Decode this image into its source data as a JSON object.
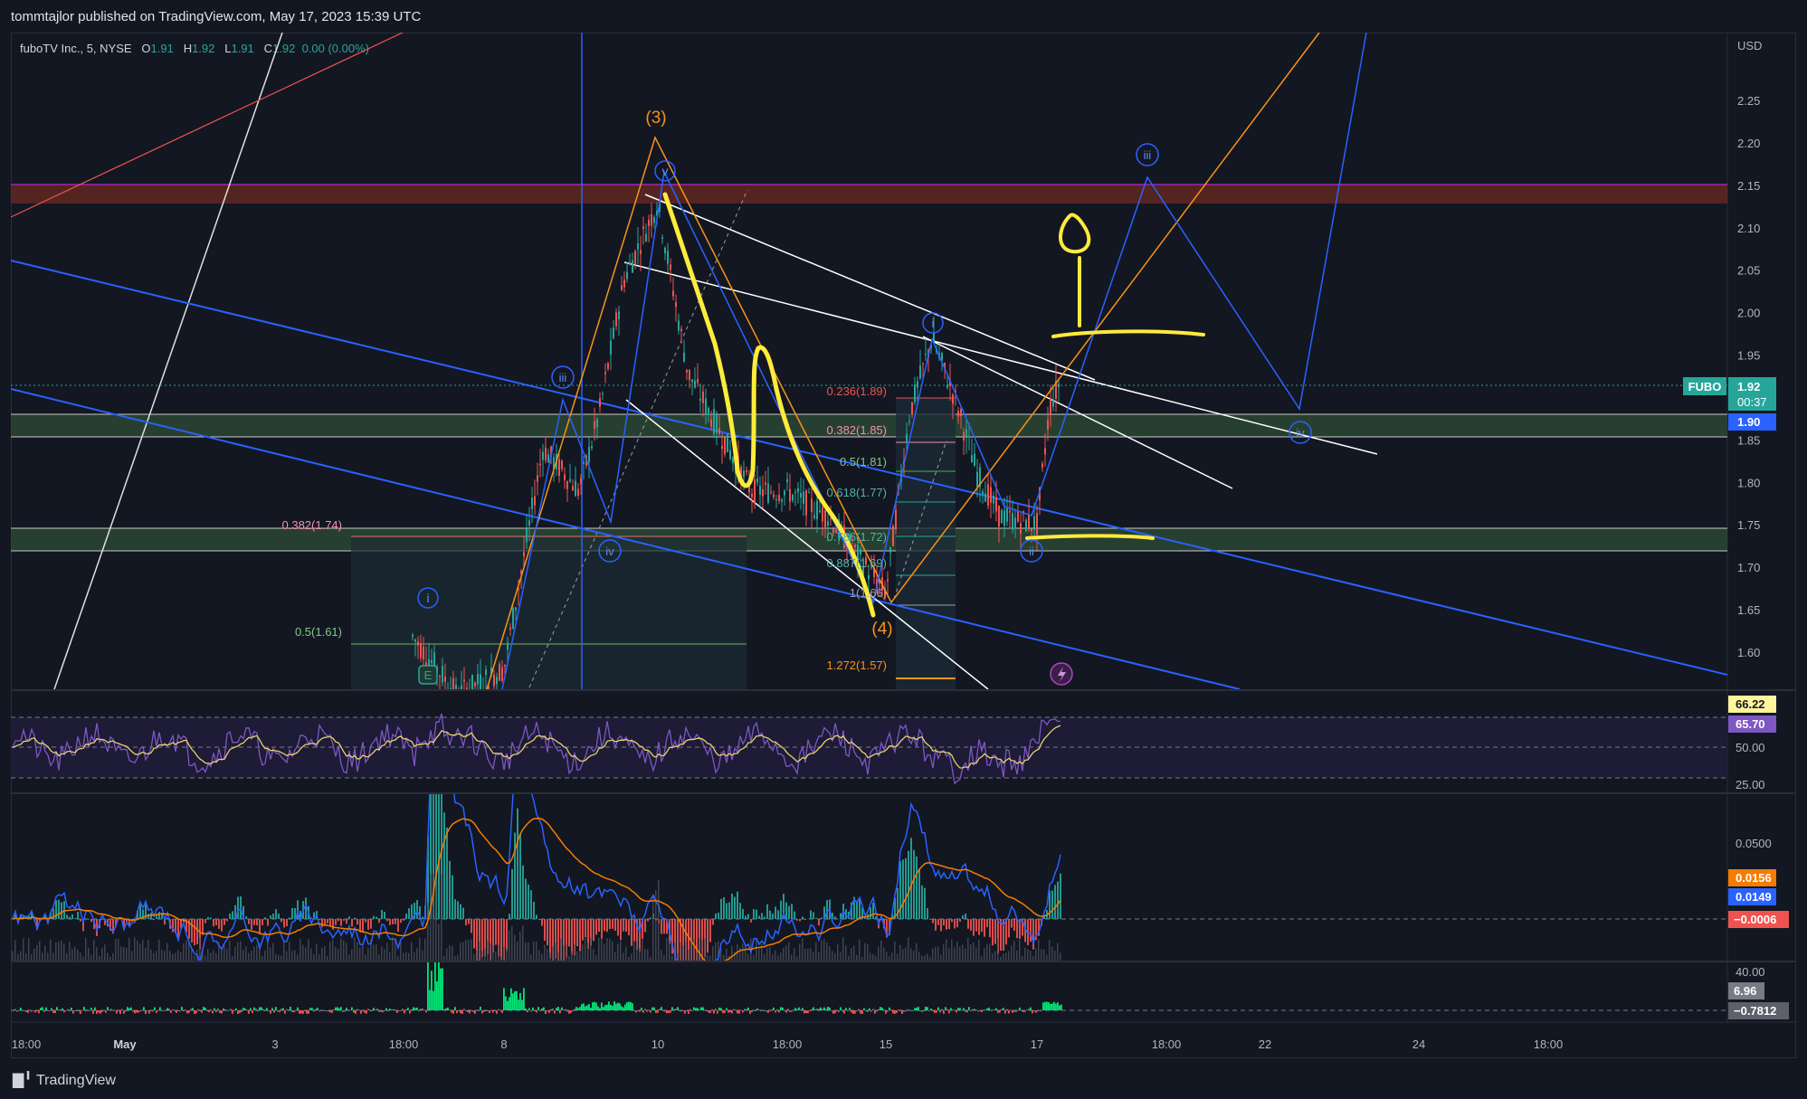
{
  "header": {
    "published_text": "tommtajlor published on TradingView.com, May 17, 2023 15:39 UTC"
  },
  "symbol_info": {
    "name": "fuboTV Inc., 5, NYSE",
    "o_label": "O",
    "o_value": "1.91",
    "h_label": "H",
    "h_value": "1.92",
    "l_label": "L",
    "l_value": "1.91",
    "c_label": "C",
    "c_value": "1.92",
    "change": "0.00 (0.00%)"
  },
  "footer": {
    "brand": "TradingView"
  },
  "colors": {
    "background": "#131722",
    "up": "#26a69a",
    "blue_lines": "#2962ff",
    "orange": "#f7931a",
    "yellow_marker": "#ffeb3b",
    "rsi_purple": "#7e57c2",
    "zone_red": "#a1412e",
    "zone_green": "#2f4d3a"
  },
  "price_axis": {
    "currency": "USD",
    "ticks": [
      "2.25",
      "2.20",
      "2.15",
      "2.10",
      "2.05",
      "2.00",
      "1.95",
      "1.90",
      "1.85",
      "1.80",
      "1.75",
      "1.70",
      "1.65",
      "1.60"
    ],
    "symbol_tag": "FUBO",
    "last_price": "1.92",
    "countdown": "00:37",
    "line_price": "1.90"
  },
  "rsi_axis": {
    "ticks": [
      "50.00",
      "25.00"
    ],
    "value_yellow": "66.22",
    "value_purple": "65.70"
  },
  "macd_axis": {
    "tick": "0.0500",
    "value_orange": "0.0156",
    "value_blue": "0.0149",
    "value_red": "−0.0006"
  },
  "vol_osc_axis": {
    "tick": "40.00",
    "value_gray": "6.96",
    "value_dark": "−0.7812"
  },
  "time_axis": {
    "labels": [
      "18:00",
      "May",
      "3",
      "18:00",
      "8",
      "10",
      "18:00",
      "15",
      "17",
      "18:00",
      "22",
      "24",
      "18:00"
    ]
  },
  "annotations": {
    "wave_3": "(3)",
    "wave_4": "(4)",
    "wave_v": "v",
    "wave_i_top": "i",
    "wave_i_left": "i",
    "wave_iii_left": "iii",
    "wave_iii_right": "iii",
    "wave_iv_left": "iv",
    "wave_iv_right": "iv",
    "wave_ii": "ii",
    "earnings_marker": "E",
    "fib_left_0382": "0.382(1.74)",
    "fib_left_05": "0.5(1.61)",
    "fib_0236": "0.236(1.89)",
    "fib_0382": "0.382(1.85)",
    "fib_05": "0.5(1.81)",
    "fib_0618": "0.618(1.77)",
    "fib_0786": "0.786(1.72)",
    "fib_0887": "0.887(1.69)",
    "fib_1": "1(1.66)",
    "fib_1272": "1.272(1.57)"
  },
  "chart_data": {
    "type": "line",
    "title": "fuboTV Inc., 5, NYSE",
    "xlabel": "",
    "ylabel": "USD",
    "ylim": [
      1.55,
      2.3
    ],
    "x": [
      "18:00",
      "May",
      "3",
      "18:00",
      "8",
      "10",
      "18:00",
      "15",
      "17",
      "18:00",
      "22",
      "24",
      "18:00"
    ],
    "series": [
      {
        "name": "fuboTV Inc., 5, NYSE",
        "points": [
          [
            "May 4 18:00",
            1.62
          ],
          [
            "May 5",
            1.55
          ],
          [
            "May 8",
            1.58
          ],
          [
            "May 8 14:00",
            1.84
          ],
          [
            "May 9",
            1.79
          ],
          [
            "May 9 12:00",
            1.88
          ],
          [
            "May 9 18:00",
            2.04
          ],
          [
            "May 10",
            2.13
          ],
          [
            "May 10 14:00",
            1.93
          ],
          [
            "May 11",
            1.86
          ],
          [
            "May 11 14:00",
            1.79
          ],
          [
            "May 12",
            1.79
          ],
          [
            "May 12 14:00",
            1.76
          ],
          [
            "May 15",
            1.67
          ],
          [
            "May 15 14:00",
            1.88
          ],
          [
            "May 15 18:00",
            1.97
          ],
          [
            "May 16",
            1.9
          ],
          [
            "May 16 14:00",
            1.81
          ],
          [
            "May 16 18:00",
            1.76
          ],
          [
            "May 17",
            1.75
          ],
          [
            "May 17 10:00",
            1.89
          ],
          [
            "May 17 15:39",
            1.92
          ]
        ]
      }
    ],
    "zones": [
      {
        "low": 2.13,
        "high": 2.15
      },
      {
        "low": 1.86,
        "high": 1.88
      },
      {
        "low": 1.72,
        "high": 1.745
      }
    ],
    "fib_levels_left": [
      {
        "ratio": "0.382",
        "price": 1.74
      },
      {
        "ratio": "0.5",
        "price": 1.61
      }
    ],
    "fib_levels_right": [
      {
        "ratio": "0.236",
        "price": 1.89
      },
      {
        "ratio": "0.382",
        "price": 1.85
      },
      {
        "ratio": "0.5",
        "price": 1.81
      },
      {
        "ratio": "0.618",
        "price": 1.77
      },
      {
        "ratio": "0.786",
        "price": 1.72
      },
      {
        "ratio": "0.887",
        "price": 1.69
      },
      {
        "ratio": "1",
        "price": 1.66
      },
      {
        "ratio": "1.272",
        "price": 1.57
      }
    ],
    "rsi": {
      "values_last": [
        66.22,
        65.7
      ],
      "levels": [
        70,
        50,
        30
      ]
    },
    "macd": {
      "last": [
        0.0156,
        0.0149,
        -0.0006
      ]
    },
    "oscillator": {
      "last": [
        6.96,
        -0.7812
      ]
    }
  }
}
